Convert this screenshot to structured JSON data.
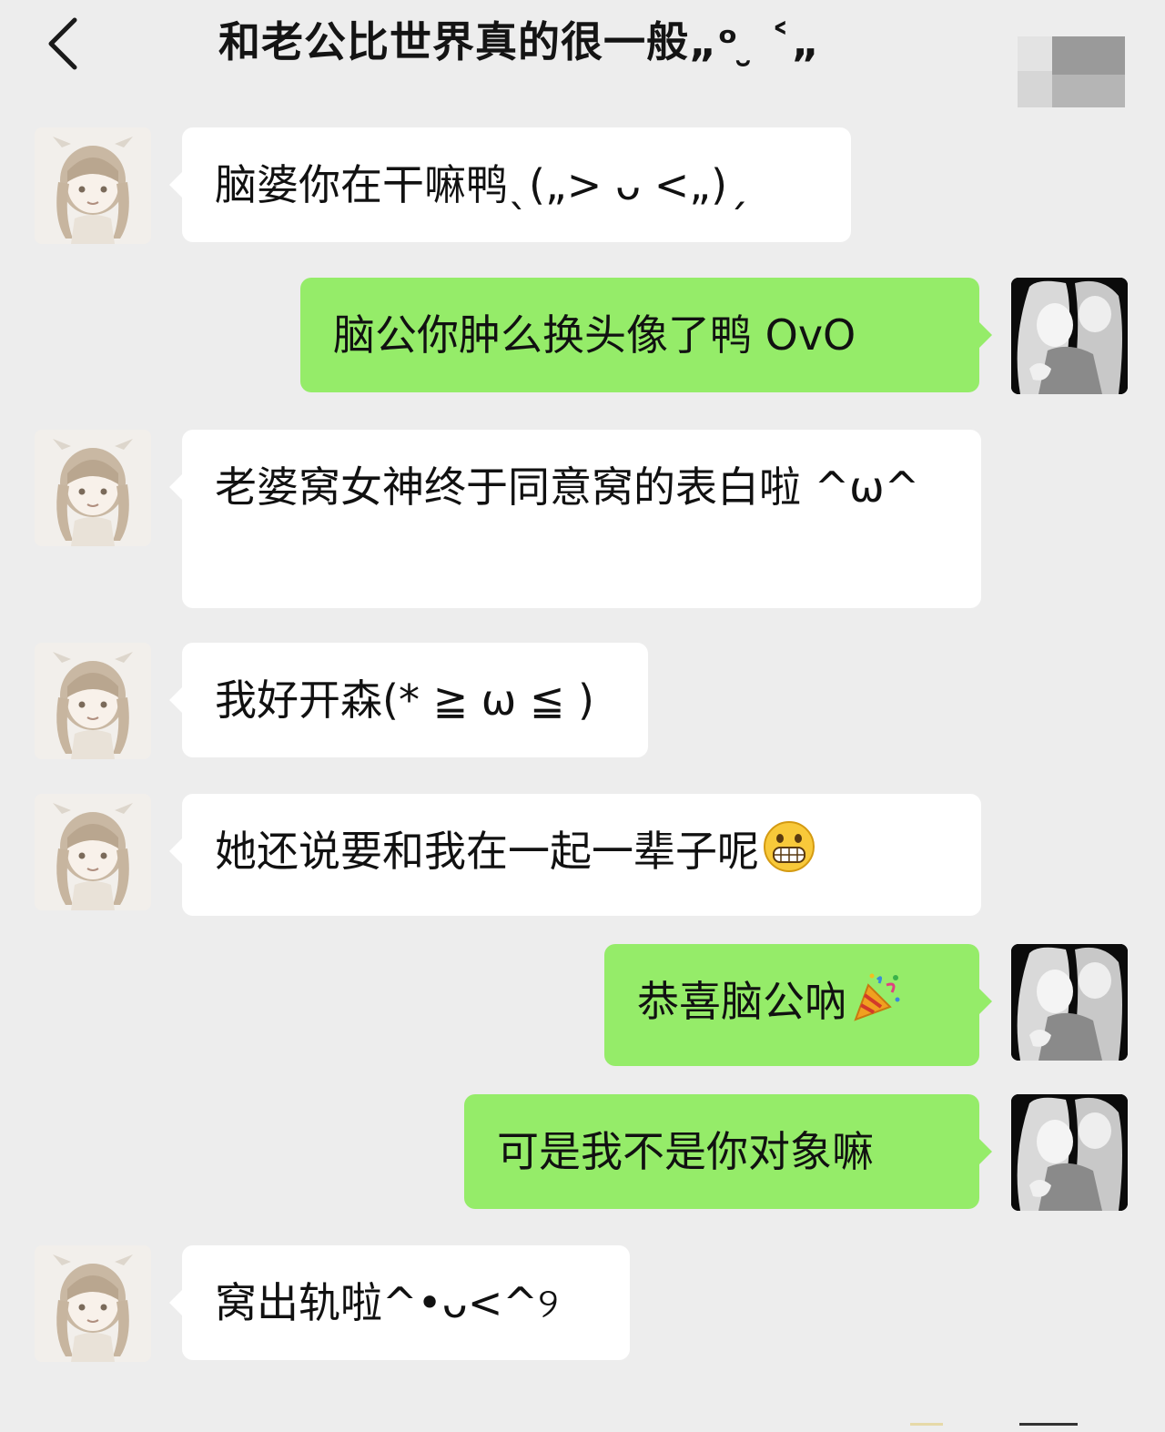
{
  "header": {
    "title": "和老公比世界真的很一般„ᵒ ̮ ˂„",
    "back_icon": "chevron-left-icon",
    "more_icon": "blurred-menu-icon"
  },
  "colors": {
    "background": "#ededed",
    "incoming_bubble": "#ffffff",
    "outgoing_bubble": "#95ec69",
    "text": "#111111"
  },
  "messages": [
    {
      "side": "incoming",
      "text": "脑婆你在干嘛鸭ˎ(„> ᴗ <„)ˏ"
    },
    {
      "side": "outgoing",
      "text": "脑公你肿么换头像了鸭 OvO"
    },
    {
      "side": "incoming",
      "text": "老婆窝女神终于同意窝的表白啦 ^ω^"
    },
    {
      "side": "incoming",
      "text": "我好开森(* ≧ ω ≦ )"
    },
    {
      "side": "incoming",
      "text": "她还说要和我在一起一辈子呢",
      "emoji": "grinning-face-icon"
    },
    {
      "side": "outgoing",
      "text": "恭喜脑公吶",
      "emoji": "party-popper-icon"
    },
    {
      "side": "outgoing",
      "text": "可是我不是你对象嘛"
    },
    {
      "side": "incoming",
      "text": "窝出轨啦^•ᴗ<^୨"
    }
  ]
}
